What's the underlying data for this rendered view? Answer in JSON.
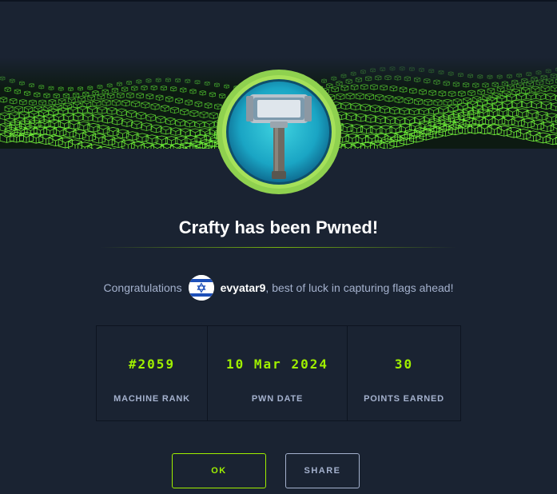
{
  "header": {
    "title": "Crafty has been Pwned!"
  },
  "badge": {
    "icon": "hammer-icon",
    "ring_color": "#9fef00",
    "fill_color": "#1fb6c9"
  },
  "congrats": {
    "prefix": "Congratulations",
    "username": "evyatar9",
    "suffix": ", best of luck in capturing flags ahead!",
    "avatar_icon": "israel-flag-icon"
  },
  "stats": [
    {
      "value": "#2059",
      "label": "MACHINE RANK"
    },
    {
      "value": "10 Mar 2024",
      "label": "PWN DATE"
    },
    {
      "value": "30",
      "label": "POINTS EARNED"
    }
  ],
  "actions": {
    "ok_label": "OK",
    "share_label": "SHARE"
  },
  "colors": {
    "background": "#1a2332",
    "accent": "#9fef00",
    "text_muted": "#a4b1cd"
  }
}
